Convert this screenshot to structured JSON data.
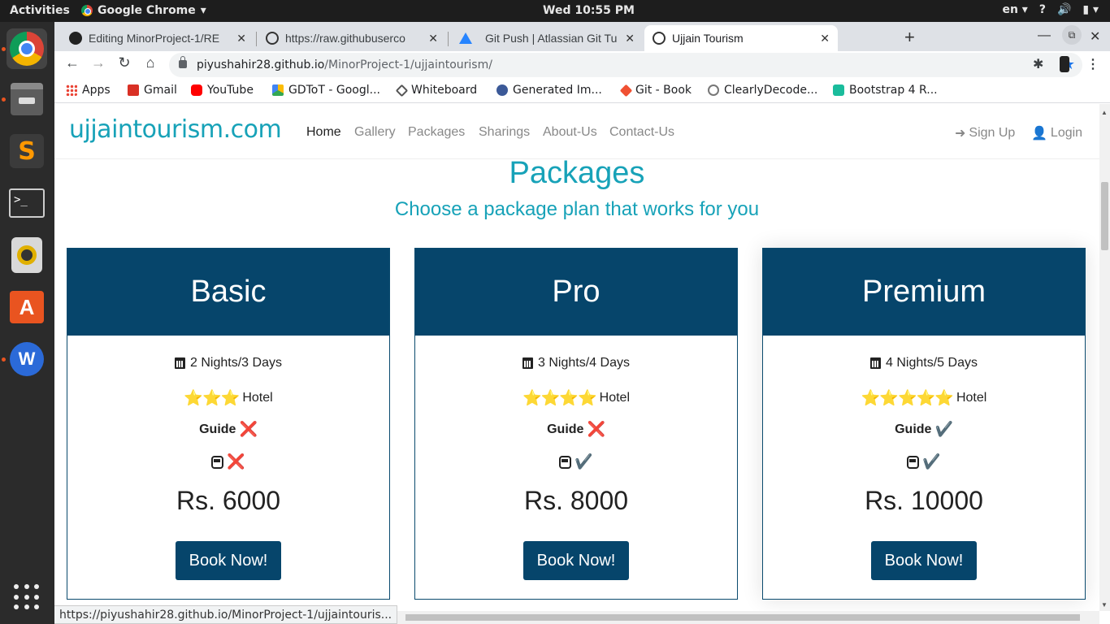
{
  "topbar": {
    "activities": "Activities",
    "app_name": "Google Chrome",
    "clock": "Wed 10:55 PM",
    "lang": "en"
  },
  "tabs": [
    {
      "title": "Editing MinorProject-1/RE",
      "icon": "github-icon"
    },
    {
      "title": "https://raw.githubuserco",
      "icon": "globe-icon"
    },
    {
      "title": "Git Push | Atlassian Git Tu",
      "icon": "atlassian-icon"
    },
    {
      "title": "Ujjain Tourism",
      "icon": "globe-icon"
    }
  ],
  "address": {
    "host": "piyushahir28.github.io",
    "path": "/MinorProject-1/ujjaintourism/"
  },
  "bookmarks": [
    {
      "label": "Apps",
      "color": "#ea4335"
    },
    {
      "label": "Gmail",
      "color": "#d93025"
    },
    {
      "label": "YouTube",
      "color": "#ff0000"
    },
    {
      "label": "GDToT - Googl...",
      "color": "#34a853"
    },
    {
      "label": "Whiteboard",
      "color": "#555555"
    },
    {
      "label": "Generated Im...",
      "color": "#3b5998"
    },
    {
      "label": "Git - Book",
      "color": "#f05133"
    },
    {
      "label": "ClearlyDecode...",
      "color": "#777777"
    },
    {
      "label": "Bootstrap 4 R...",
      "color": "#1abc9c"
    }
  ],
  "site": {
    "brand": "ujjaintourism.com",
    "nav": [
      "Home",
      "Gallery",
      "Packages",
      "Sharings",
      "About-Us",
      "Contact-Us"
    ],
    "signup": "Sign Up",
    "login": "Login",
    "title": "Packages",
    "subtitle": "Choose a package plan that works for you"
  },
  "packages": [
    {
      "name": "Basic",
      "duration": "2 Nights/3 Days",
      "stars": "⭐⭐⭐",
      "hotel": "Hotel",
      "guide_label": "Guide",
      "guide": "❌",
      "transport": "❌",
      "price": "Rs. 6000",
      "button": "Book Now!"
    },
    {
      "name": "Pro",
      "duration": "3 Nights/4 Days",
      "stars": "⭐⭐⭐⭐",
      "hotel": "Hotel",
      "guide_label": "Guide",
      "guide": "❌",
      "transport": "✔️",
      "price": "Rs. 8000",
      "button": "Book Now!"
    },
    {
      "name": "Premium",
      "duration": "4 Nights/5 Days",
      "stars": "⭐⭐⭐⭐⭐",
      "hotel": "Hotel",
      "guide_label": "Guide",
      "guide": "✔️",
      "transport": "✔️",
      "price": "Rs. 10000",
      "button": "Book Now!"
    }
  ],
  "status_url": "https://piyushahir28.github.io/MinorProject-1/ujjaintouris..."
}
